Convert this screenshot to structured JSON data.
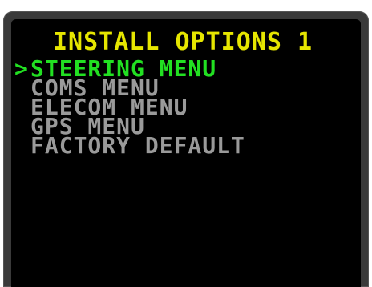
{
  "screen": {
    "title": "INSTALL OPTIONS 1",
    "cursor": ">",
    "colors": {
      "title": "#e6e600",
      "selected": "#22e022",
      "unselected": "#9a9a9a",
      "background": "#000000"
    },
    "menu": [
      {
        "label": "STEERING MENU",
        "selected": true
      },
      {
        "label": "COMS MENU",
        "selected": false
      },
      {
        "label": "ELECOM MENU",
        "selected": false
      },
      {
        "label": "GPS MENU",
        "selected": false
      },
      {
        "label": "FACTORY DEFAULT",
        "selected": false
      }
    ]
  }
}
